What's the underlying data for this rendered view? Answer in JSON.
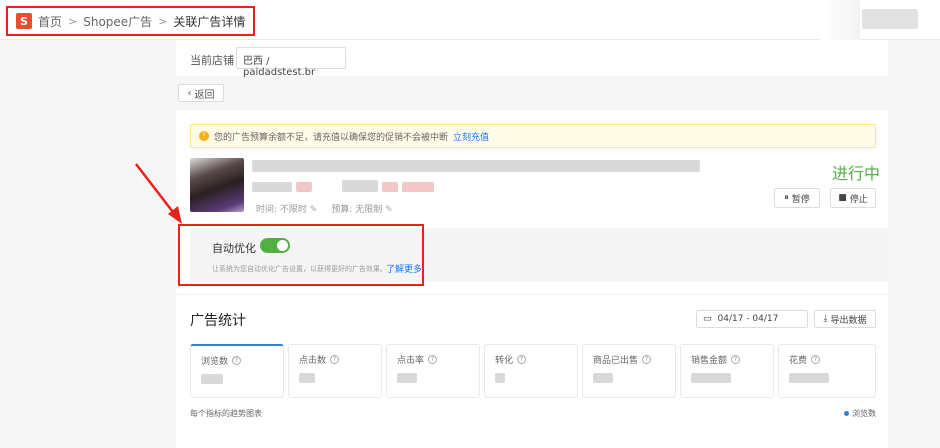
{
  "breadcrumb": {
    "home": "首页",
    "ads": "Shopee广告",
    "current": "关联广告详情"
  },
  "shop": {
    "label": "当前店铺",
    "value": "巴西 / paidadstest.br"
  },
  "back_label": "返回",
  "warning": {
    "text": "您的广告预算余额不足，请充值以确保您的促销不会被中断",
    "link": "立刻充值"
  },
  "ad": {
    "status": "进行中",
    "time_label": "时间: 不限时",
    "budget_label": "预算: 无限制",
    "pause_label": "暂停",
    "stop_label": "停止",
    "status_color": "#52b043"
  },
  "auto_opt": {
    "title": "自动优化",
    "enabled": true,
    "desc": "让系统为您自动优化广告设置，以获得更好的广告效果。",
    "link": "了解更多"
  },
  "stats": {
    "title": "广告统计",
    "date_range": "04/17 - 04/17",
    "export_label": "导出数据",
    "metrics": [
      {
        "label": "浏览数"
      },
      {
        "label": "点击数"
      },
      {
        "label": "点击率"
      },
      {
        "label": "转化"
      },
      {
        "label": "商品已出售"
      },
      {
        "label": "销售金额"
      },
      {
        "label": "花费"
      }
    ],
    "trend_label": "每个指标的趋势图表",
    "legend_label": "浏览数"
  },
  "accent_colors": {
    "highlight": "#e8231b",
    "brand": "#ee4d2d",
    "link": "#1677ff"
  }
}
